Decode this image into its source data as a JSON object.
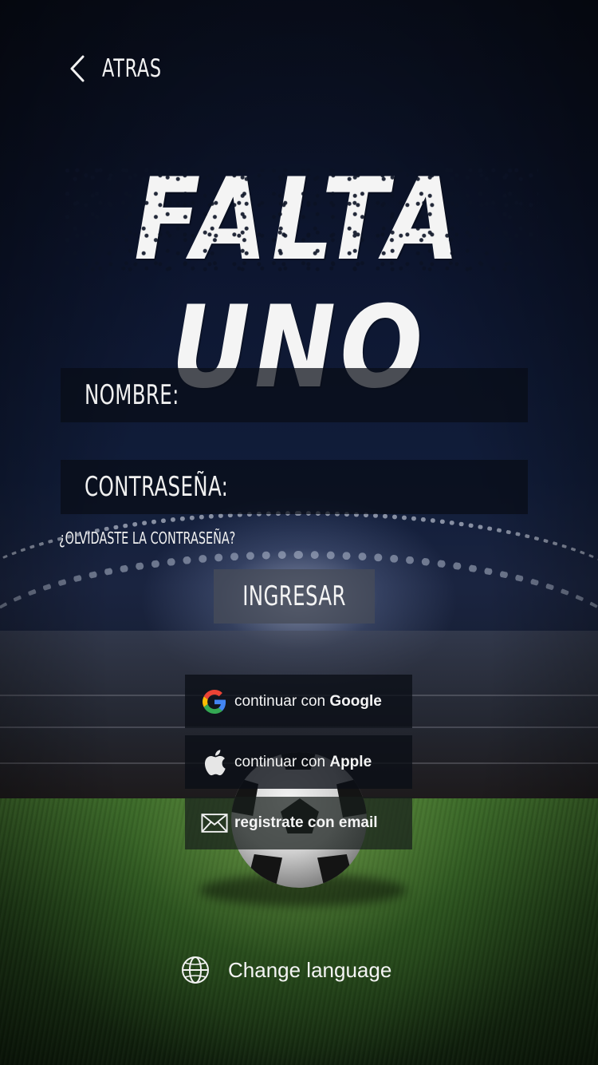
{
  "nav": {
    "back_label": "ATRAS",
    "back_icon": "chevron-left-icon"
  },
  "brand": {
    "logo_text": "FALTA UNO"
  },
  "form": {
    "name_label": "NOMBRE:",
    "name_value": "",
    "password_label": "CONTRASEÑA:",
    "password_value": "",
    "forgot_label": "¿OLVIDASTE LA CONTRASEÑA?",
    "submit_label": "INGRESAR"
  },
  "social": {
    "google": {
      "prefix": "continuar con ",
      "provider": "Google",
      "icon": "google-icon"
    },
    "apple": {
      "prefix": "continuar con ",
      "provider": "Apple",
      "icon": "apple-icon"
    },
    "email": {
      "label": "registrate con email",
      "icon": "envelope-icon"
    }
  },
  "footer": {
    "language_label": "Change language",
    "language_icon": "globe-icon"
  },
  "colors": {
    "google_blue": "#4285F4",
    "google_red": "#EA4335",
    "google_yellow": "#FBBC05",
    "google_green": "#34A853",
    "text": "#F4F4F4"
  }
}
